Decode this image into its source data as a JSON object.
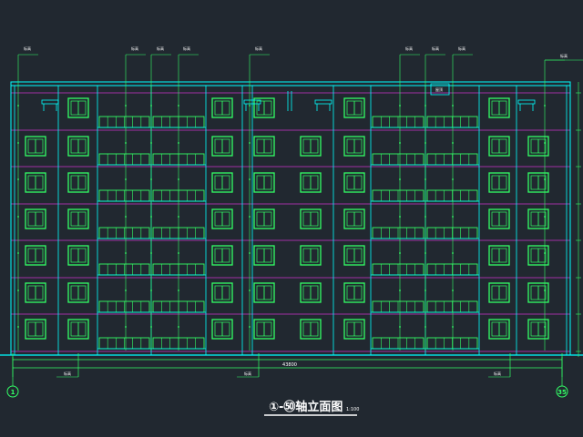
{
  "drawing": {
    "title": "①-㊿轴立面图",
    "scale": "1:100",
    "total_dimension": "43800",
    "axis_start": "1",
    "axis_end": "35"
  },
  "colors": {
    "background": "#212830",
    "wall": "#00ffff",
    "window": "#33ff66",
    "floor_line": "#cc33cc",
    "dimension": "#33ff66",
    "annotation": "#33ff66"
  },
  "building": {
    "floors": 7,
    "window_columns": 12,
    "balcony_bays": 4
  },
  "notes": {
    "top_labels": [
      "标高",
      "标高",
      "标高",
      "标高",
      "标高",
      "标高",
      "标高",
      "标高",
      "标高"
    ],
    "bottom_labels": [
      "标高",
      "标高",
      "标高"
    ],
    "right_label": "标高",
    "roof_tag": "屋顶"
  }
}
